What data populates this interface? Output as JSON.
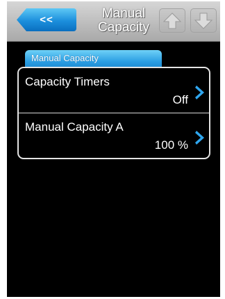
{
  "header": {
    "back_label": "<<",
    "title_line1": "Manual",
    "title_line2": "Capacity"
  },
  "section": {
    "tab_label": "Manual Capacity"
  },
  "menu": {
    "items": [
      {
        "label": "Capacity Timers",
        "value": "Off"
      },
      {
        "label": "Manual Capacity A",
        "value": "100 %"
      }
    ]
  },
  "colors": {
    "accent": "#1c8fdc",
    "header_bg": "#bdbdbd",
    "panel_bg": "#000000",
    "text": "#ffffff"
  },
  "icons": [
    "back-arrow-icon",
    "up-arrow-icon",
    "down-arrow-icon",
    "chevron-right-icon"
  ]
}
